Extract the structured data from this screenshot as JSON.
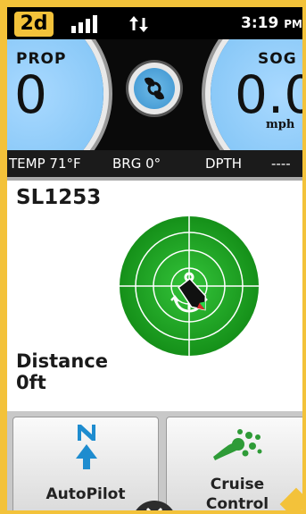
{
  "step_badge": "2d",
  "status": {
    "time": "3:19",
    "ampm": "PM",
    "signal_icon": "signal-bars-icon",
    "data_icon": "data-transfer-icon"
  },
  "gauges": {
    "prop": {
      "label": "PROP",
      "value": "0"
    },
    "sog": {
      "label": "SOG",
      "value": "0.0",
      "unit": "mph"
    },
    "center_icon": "propeller-icon"
  },
  "info": {
    "temp": "TEMP 71°F",
    "brg": "BRG  0°",
    "dpth_label": "DPTH",
    "dpth_value": "----"
  },
  "main": {
    "waypoint": "SL1253",
    "distance_label": "Distance",
    "distance_value": "0ft",
    "radar_icon": "anchor-icon",
    "boat_icon": "boat-icon"
  },
  "buttons": {
    "autopilot": {
      "label": "AutoPilot",
      "icon": "north-arrow-icon"
    },
    "cruise": {
      "label_line1": "Cruise",
      "label_line2": "Control",
      "icon": "cruise-control-icon"
    }
  },
  "colors": {
    "frame": "#f3c23a",
    "radar_green": "#1fa521",
    "gauge_blue": "#7fc3f5",
    "autopilot_blue": "#1e8ccf",
    "cruise_green": "#2e9b37"
  }
}
